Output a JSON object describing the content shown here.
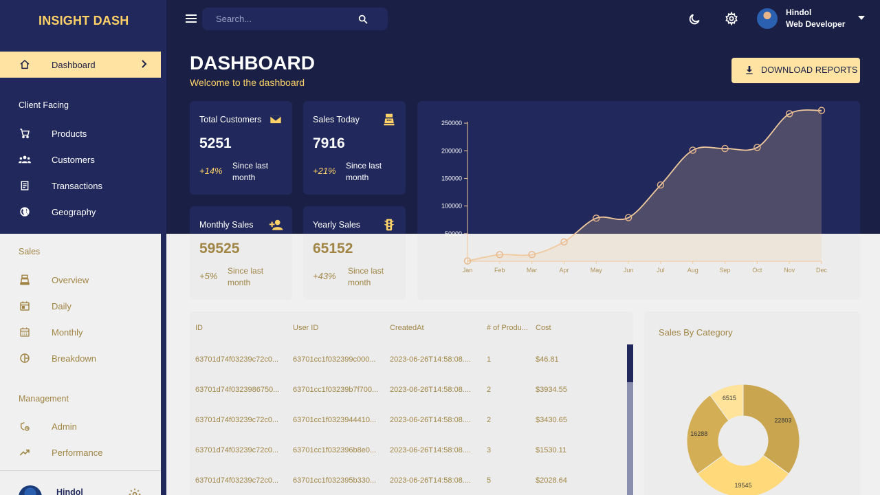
{
  "brand": "INSIGHT DASH",
  "sidebar": {
    "active_item": {
      "label": "Dashboard",
      "icon": "home-icon"
    },
    "sections": [
      {
        "title": "Client Facing",
        "items": [
          {
            "label": "Products",
            "icon": "shopping-cart-icon"
          },
          {
            "label": "Customers",
            "icon": "groups-icon"
          },
          {
            "label": "Transactions",
            "icon": "receipt-icon"
          },
          {
            "label": "Geography",
            "icon": "globe-icon"
          }
        ]
      },
      {
        "title": "Sales",
        "items": [
          {
            "label": "Overview",
            "icon": "point-of-sale-icon"
          },
          {
            "label": "Daily",
            "icon": "calendar-day-icon"
          },
          {
            "label": "Monthly",
            "icon": "calendar-month-icon"
          },
          {
            "label": "Breakdown",
            "icon": "pie-chart-icon"
          }
        ]
      },
      {
        "title": "Management",
        "items": [
          {
            "label": "Admin",
            "icon": "admin-icon"
          },
          {
            "label": "Performance",
            "icon": "trending-up-icon"
          }
        ]
      }
    ],
    "footer_user": "Hindol"
  },
  "topbar": {
    "search_placeholder": "Search...",
    "user_name": "Hindol",
    "user_role": "Web Developer"
  },
  "header": {
    "title": "DASHBOARD",
    "subtitle": "Welcome to the dashboard",
    "download_label": "DOWNLOAD REPORTS"
  },
  "stats": [
    {
      "title": "Total Customers",
      "value": "5251",
      "change": "+14%",
      "since": "Since last month",
      "icon": "email-icon"
    },
    {
      "title": "Sales Today",
      "value": "7916",
      "change": "+21%",
      "since": "Since last month",
      "icon": "point-of-sale-icon"
    },
    {
      "title": "Monthly Sales",
      "value": "59525",
      "change": "+5%",
      "since": "Since last month",
      "icon": "person-add-icon"
    },
    {
      "title": "Yearly Sales",
      "value": "65152",
      "change": "+43%",
      "since": "Since last month",
      "icon": "traffic-icon"
    }
  ],
  "chart_data": {
    "type": "area",
    "x": [
      "Jan",
      "Feb",
      "Mar",
      "Apr",
      "May",
      "Jun",
      "Jul",
      "Aug",
      "Sep",
      "Oct",
      "Nov",
      "Dec"
    ],
    "y": [
      500,
      12000,
      12000,
      35000,
      78000,
      79000,
      138000,
      201000,
      204000,
      206000,
      267000,
      273000
    ],
    "yticks": [
      50000,
      100000,
      150000,
      200000,
      250000
    ],
    "ylim": [
      0,
      280000
    ],
    "title": "",
    "xlabel": "",
    "ylabel": "",
    "line_color": "#f0c99d",
    "fill_color": "#f0c99d"
  },
  "table": {
    "headers": [
      "ID",
      "User ID",
      "CreatedAt",
      "# of Produ...",
      "Cost"
    ],
    "rows": [
      [
        "63701d74f03239c72c0...",
        "63701cc1f032399c000...",
        "2023-06-26T14:58:08....",
        "1",
        "$46.81"
      ],
      [
        "63701d74f0323986750...",
        "63701cc1f03239b7f700...",
        "2023-06-26T14:58:08....",
        "2",
        "$3934.55"
      ],
      [
        "63701d74f03239c72c0...",
        "63701cc1f0323944410...",
        "2023-06-26T14:58:08....",
        "2",
        "$3430.65"
      ],
      [
        "63701d74f03239c72c0...",
        "63701cc1f032396b8e0...",
        "2023-06-26T14:58:08....",
        "3",
        "$1530.11"
      ],
      [
        "63701d74f03239c72c0...",
        "63701cc1f032395b330...",
        "2023-06-26T14:58:08....",
        "5",
        "$2028.64"
      ]
    ]
  },
  "pie": {
    "title": "Sales By Category",
    "slices": [
      {
        "value": 22803,
        "label": "22803",
        "color": "#c9a54f"
      },
      {
        "value": 19545,
        "label": "19545",
        "color": "#ffd97a"
      },
      {
        "value": 16288,
        "label": "16288",
        "color": "#d4ae55"
      },
      {
        "value": 6515,
        "label": "6515",
        "color": "#ffe39a"
      }
    ]
  },
  "colors": {
    "primary_dark": "#191f45",
    "primary": "#21295c",
    "accent": "#ffd166",
    "accent_light": "#ffe3a3",
    "light_bg": "#f0f0f0",
    "muted_gold": "#a08545"
  }
}
